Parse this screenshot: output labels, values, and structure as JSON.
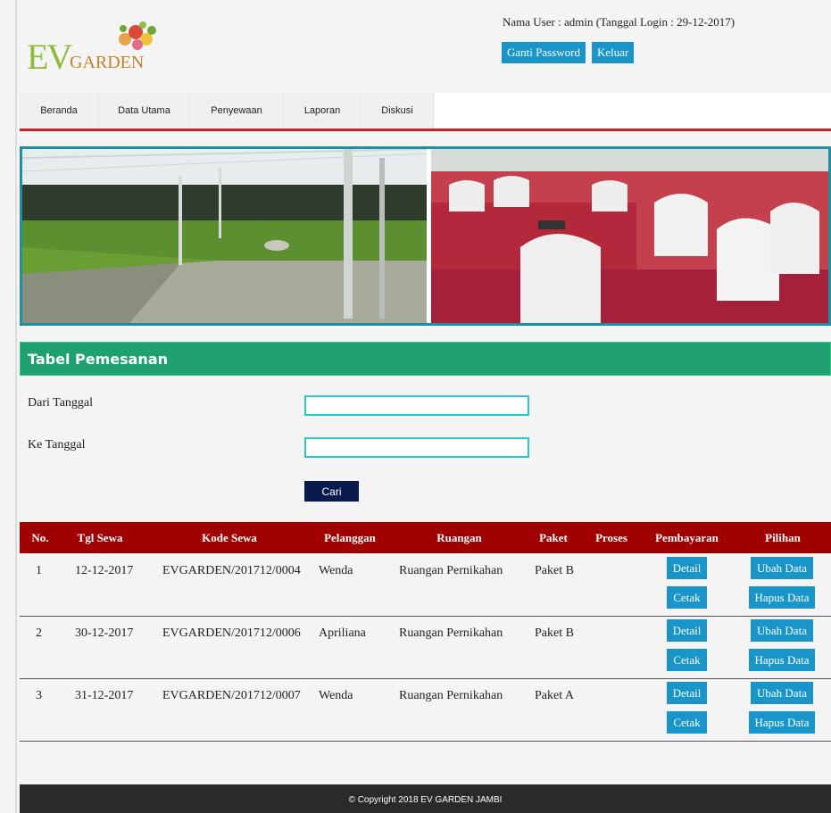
{
  "brand": {
    "logo_ev": "EV",
    "logo_garden": "GARDEN"
  },
  "header": {
    "user_info": "Nama User : admin (Tanggal Login : 29-12-2017)",
    "change_password": "Ganti Password",
    "logout": "Keluar"
  },
  "nav": {
    "items": [
      "Beranda",
      "Data Utama",
      "Penyewaan",
      "Laporan",
      "Diskusi"
    ]
  },
  "section": {
    "title": "Tabel Pemesanan"
  },
  "form": {
    "from_label": "Dari Tanggal",
    "to_label": "Ke Tanggal",
    "from_value": "",
    "to_value": "",
    "search_button": "Cari"
  },
  "table": {
    "headers": [
      "No.",
      "Tgl Sewa",
      "Kode Sewa",
      "Pelanggan",
      "Ruangan",
      "Paket",
      "Proses",
      "Pembayaran",
      "Pilihan"
    ],
    "rows": [
      {
        "no": "1",
        "date": "12-12-2017",
        "code": "EVGARDEN/201712/0004",
        "customer": "Wenda",
        "room": "Ruangan Pernikahan",
        "package": "Paket B",
        "process": ""
      },
      {
        "no": "2",
        "date": "30-12-2017",
        "code": "EVGARDEN/201712/0006",
        "customer": "Apriliana",
        "room": "Ruangan Pernikahan",
        "package": "Paket B",
        "process": ""
      },
      {
        "no": "3",
        "date": "31-12-2017",
        "code": "EVGARDEN/201712/0007",
        "customer": "Wenda",
        "room": "Ruangan Pernikahan",
        "package": "Paket A",
        "process": ""
      }
    ],
    "actions": {
      "detail": "Detail",
      "print": "Cetak",
      "edit": "Ubah Data",
      "delete": "Hapus Data"
    }
  },
  "footer": {
    "copyright": "© Copyright 2018 EV GARDEN JAMBI"
  },
  "colors": {
    "accent_blue": "#1a95c9",
    "nav_red": "#c41e26",
    "section_green": "#1ea16f",
    "table_header": "#a00000",
    "footer": "#2a2a2a"
  }
}
